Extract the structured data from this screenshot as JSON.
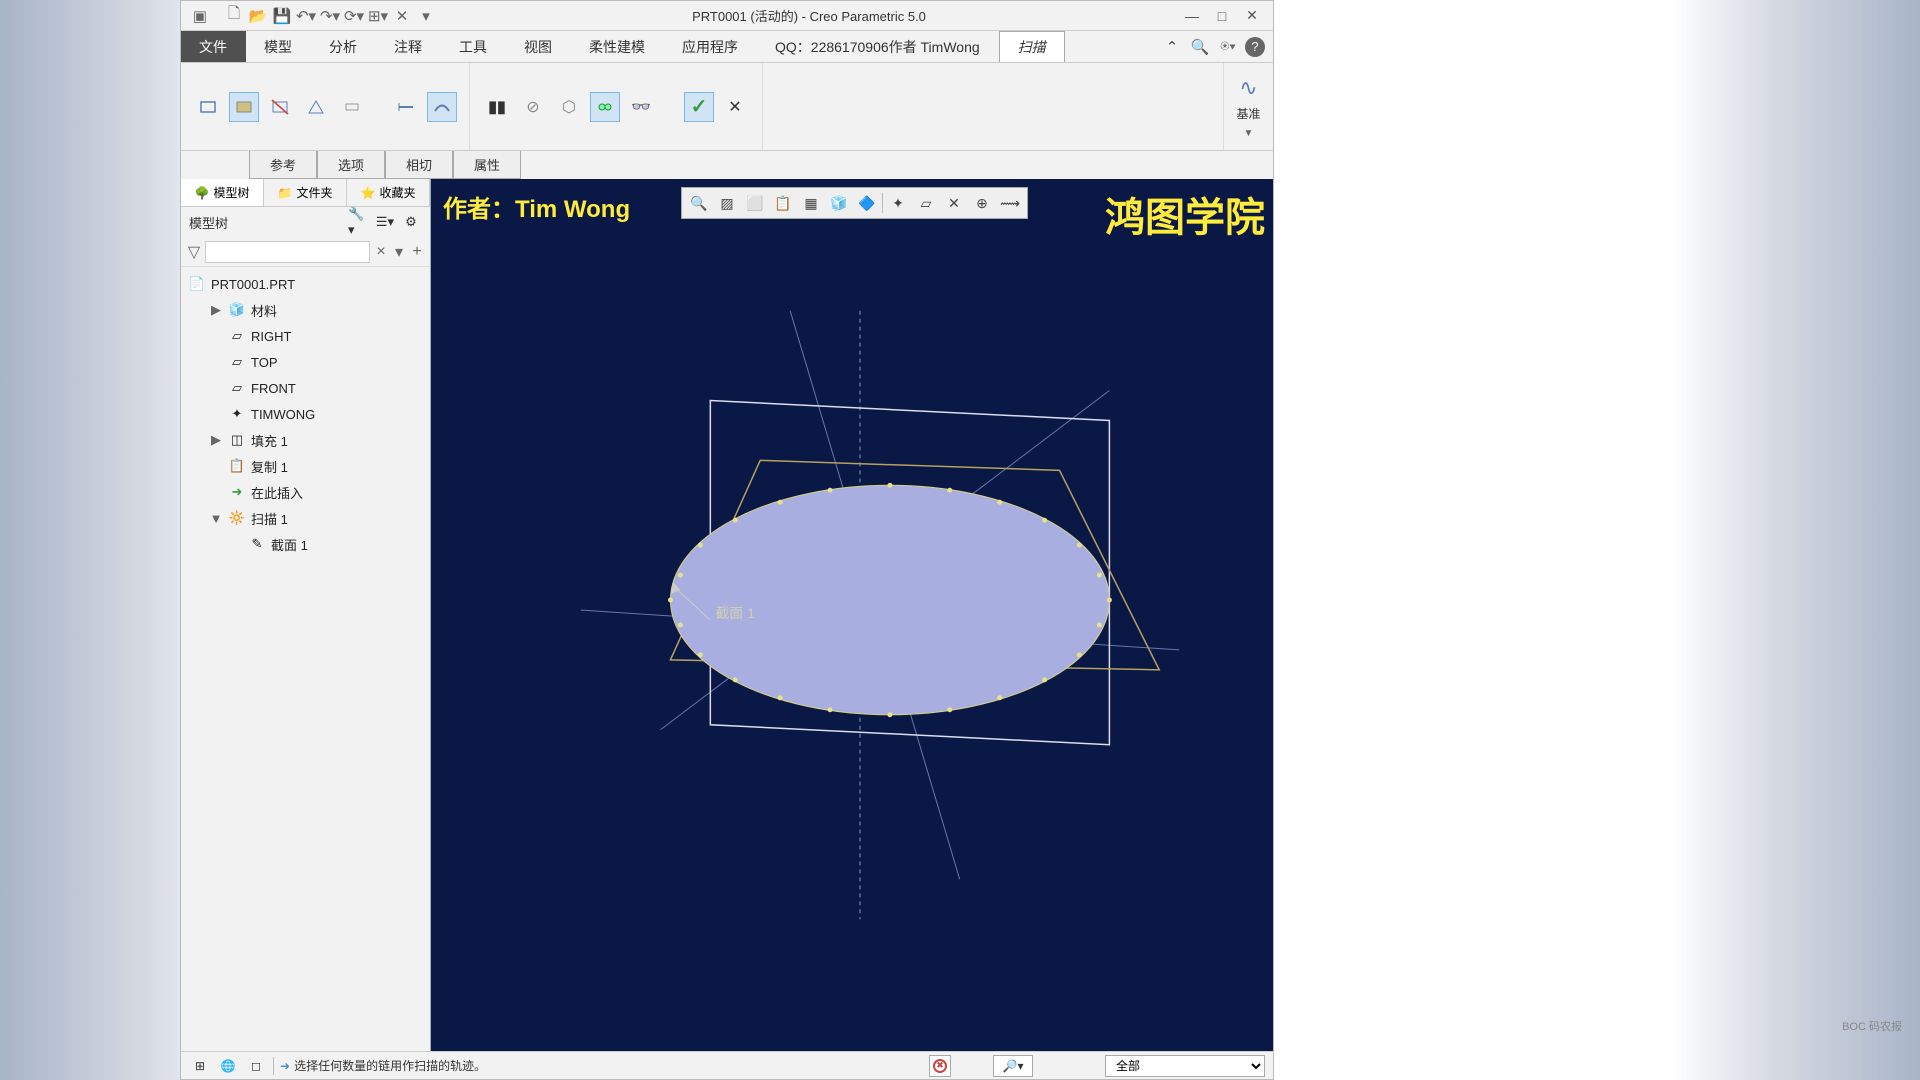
{
  "titlebar": {
    "title": "PRT0001 (活动的) - Creo Parametric 5.0"
  },
  "menubar": {
    "items": [
      "文件",
      "模型",
      "分析",
      "注释",
      "工具",
      "视图",
      "柔性建模",
      "应用程序",
      "QQ：2286170906作者 TimWong",
      "扫描"
    ],
    "search_placeholder": "搜索"
  },
  "ribbon": {
    "right_label": "基准",
    "ok_label": "✓",
    "cancel_label": "✕"
  },
  "subtabs": [
    "参考",
    "选项",
    "相切",
    "属性"
  ],
  "sidebar": {
    "tabs": [
      {
        "icon": "🌳",
        "label": "模型树"
      },
      {
        "icon": "📁",
        "label": "文件夹"
      },
      {
        "icon": "⭐",
        "label": "收藏夹"
      }
    ],
    "header": "模型树",
    "search_placeholder": "",
    "tree": [
      {
        "icon": "📄",
        "label": "PRT0001.PRT",
        "indent": 0
      },
      {
        "icon": "📦",
        "label": "材料",
        "indent": 1,
        "expandable": true
      },
      {
        "icon": "▱",
        "label": "RIGHT",
        "indent": 1
      },
      {
        "icon": "▱",
        "label": "TOP",
        "indent": 1
      },
      {
        "icon": "▱",
        "label": "FRONT",
        "indent": 1
      },
      {
        "icon": "✦",
        "label": "TIMWONG",
        "indent": 1
      },
      {
        "icon": "◫",
        "label": "填充 1",
        "indent": 1,
        "expandable": true
      },
      {
        "icon": "📋",
        "label": "复制 1",
        "indent": 1
      },
      {
        "icon": "➜",
        "label": "在此插入",
        "indent": 1,
        "green": true
      },
      {
        "icon": "🔆",
        "label": "扫描 1",
        "indent": 1,
        "expanded": true
      },
      {
        "icon": "✎",
        "label": "截面 1",
        "indent": 2
      }
    ]
  },
  "viewport": {
    "author": "作者：Tim Wong",
    "school": "鸿图学院",
    "section_label": "截面 1"
  },
  "statusbar": {
    "message": "选择任何数量的链用作扫描的轨迹。",
    "filter": "全部"
  },
  "watermark": "BOC 码农报"
}
